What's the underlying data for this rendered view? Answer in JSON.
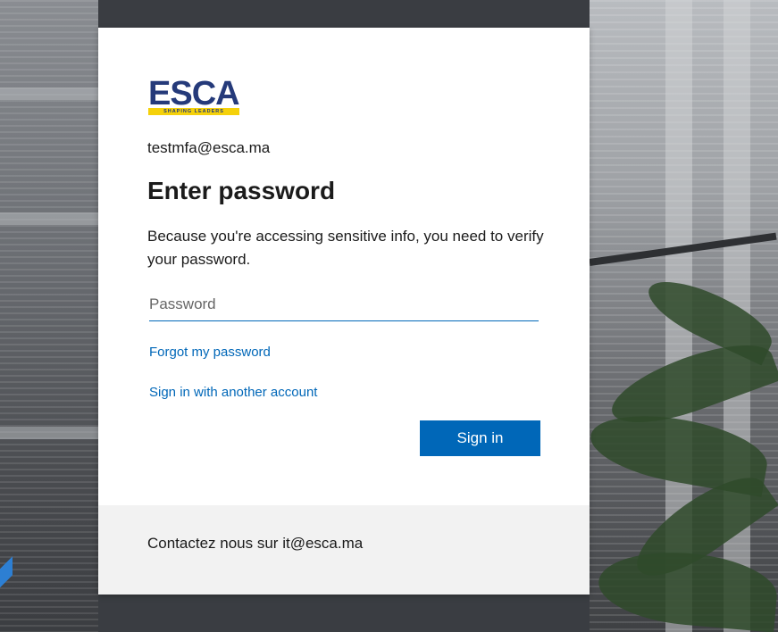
{
  "branding": {
    "logo_text": "ESCA",
    "logo_tagline": "SHAPING LEADERS",
    "brand_blue": "#253a7a",
    "brand_yellow": "#f5d10a"
  },
  "login": {
    "identity": "testmfa@esca.ma",
    "title": "Enter password",
    "description": "Because you're accessing sensitive info, you need to verify your password.",
    "password_placeholder": "Password",
    "password_value": "",
    "forgot_link": "Forgot my password",
    "other_account_link": "Sign in with another account",
    "sign_in_label": "Sign in",
    "accent_color": "#0067b8"
  },
  "footer": {
    "text": "Contactez nous sur it@esca.ma"
  }
}
